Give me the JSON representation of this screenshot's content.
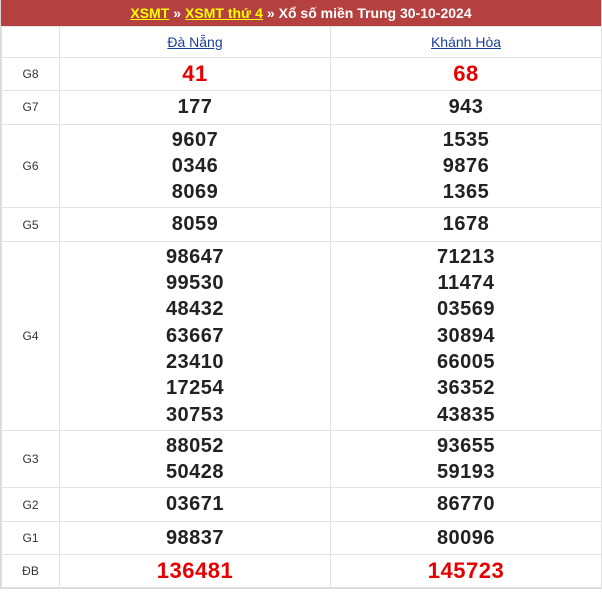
{
  "breadcrumb": {
    "link1": "XSMT",
    "sep1": "»",
    "link2": "XSMT thứ 4",
    "sep2": "»",
    "title": "Xổ số miền Trung 30-10-2024"
  },
  "provinces": [
    "Đà Nẵng",
    "Khánh Hòa"
  ],
  "prizes": [
    {
      "label": "G8",
      "highlight": true,
      "values": [
        [
          "41"
        ],
        [
          "68"
        ]
      ]
    },
    {
      "label": "G7",
      "values": [
        [
          "177"
        ],
        [
          "943"
        ]
      ]
    },
    {
      "label": "G6",
      "values": [
        [
          "9607",
          "0346",
          "8069"
        ],
        [
          "1535",
          "9876",
          "1365"
        ]
      ]
    },
    {
      "label": "G5",
      "values": [
        [
          "8059"
        ],
        [
          "1678"
        ]
      ]
    },
    {
      "label": "G4",
      "values": [
        [
          "98647",
          "99530",
          "48432",
          "63667",
          "23410",
          "17254",
          "30753"
        ],
        [
          "71213",
          "11474",
          "03569",
          "30894",
          "66005",
          "36352",
          "43835"
        ]
      ]
    },
    {
      "label": "G3",
      "values": [
        [
          "88052",
          "50428"
        ],
        [
          "93655",
          "59193"
        ]
      ]
    },
    {
      "label": "G2",
      "values": [
        [
          "03671"
        ],
        [
          "86770"
        ]
      ]
    },
    {
      "label": "G1",
      "values": [
        [
          "98837"
        ],
        [
          "80096"
        ]
      ]
    },
    {
      "label": "ĐB",
      "highlight": true,
      "values": [
        [
          "136481"
        ],
        [
          "145723"
        ]
      ]
    }
  ]
}
